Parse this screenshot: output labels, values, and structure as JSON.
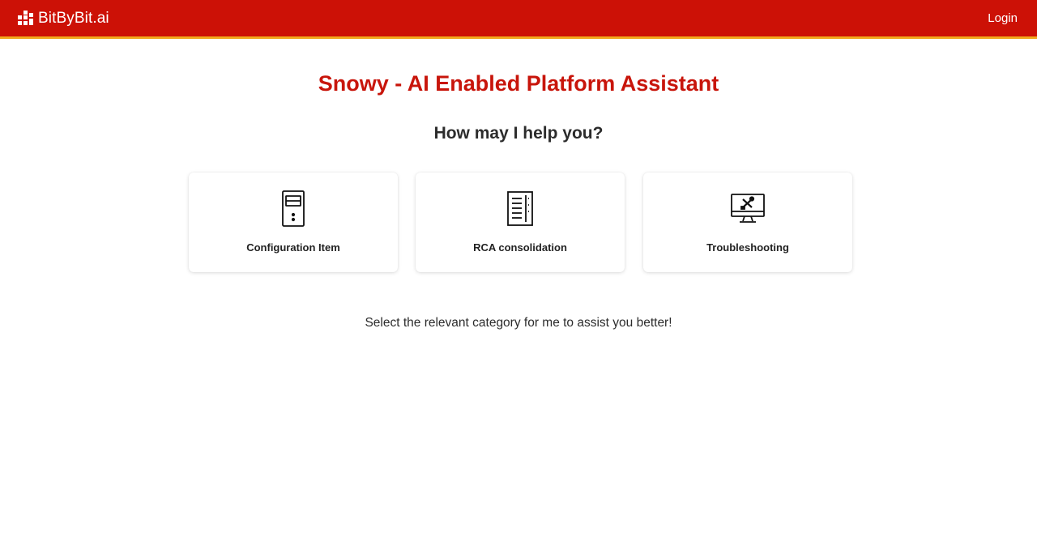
{
  "header": {
    "brand": "BitByBit.ai",
    "brand_icon": "grid-logo-icon",
    "login_label": "Login",
    "bar_color": "#cc1106",
    "accent_color": "#f2a81d"
  },
  "main": {
    "title": "Snowy - AI Enabled Platform Assistant",
    "subtitle": "How may I help you?",
    "cards": [
      {
        "label": "Configuration Item",
        "icon": "server-icon"
      },
      {
        "label": "RCA consolidation",
        "icon": "document-list-icon"
      },
      {
        "label": "Troubleshooting",
        "icon": "monitor-tools-icon"
      }
    ],
    "hint": "Select the relevant category for me to assist you better!"
  }
}
